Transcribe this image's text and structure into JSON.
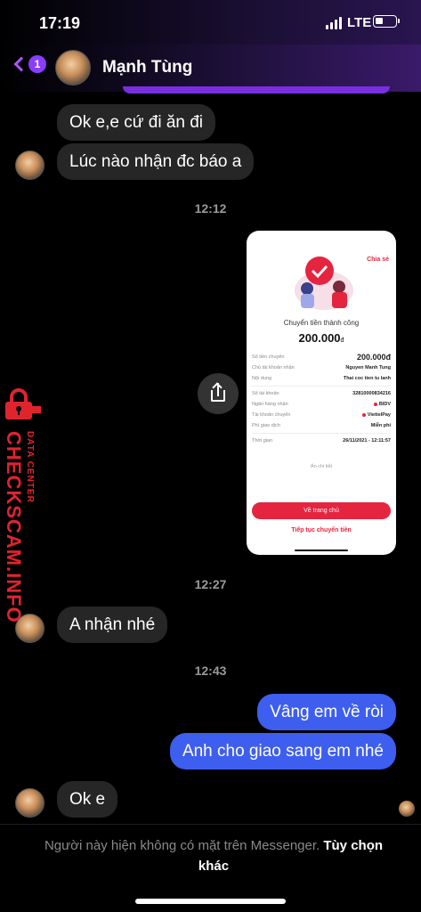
{
  "status_bar": {
    "time": "17:19",
    "network": "LTE"
  },
  "header": {
    "back_badge": "1",
    "contact_name": "Mạnh Tùng"
  },
  "messages": {
    "m1": "Ok e,e cứ đi ăn đi",
    "m2": "Lúc nào nhận đc báo a",
    "t1": "12:12",
    "t2": "12:27",
    "m3": "A nhận nhé",
    "t3": "12:43",
    "m4": "Vâng em về ròi",
    "m5": "Anh cho giao sang em nhé",
    "m6": "Ok e"
  },
  "receipt": {
    "share": "Chia sẻ",
    "title": "Chuyển tiền thành công",
    "amount": "200.000",
    "currency": "đ",
    "rows": [
      {
        "k": "Số tiền chuyển",
        "v": "200.000đ"
      },
      {
        "k": "Chủ tài khoản nhận",
        "v": "Nguyen Manh Tung"
      },
      {
        "k": "Nội dung",
        "v": "Thai coc tien tu lanh"
      },
      {
        "k": "Số tài khoản",
        "v": "32810000834216"
      },
      {
        "k": "Ngân hàng nhận",
        "v": "BIDV"
      },
      {
        "k": "Tài khoản chuyển",
        "v": "ViettelPay"
      },
      {
        "k": "Phí giao dịch",
        "v": "Miễn phí"
      },
      {
        "k": "Thời gian",
        "v": "26/11/2021 - 12:11:57"
      }
    ],
    "hide_details": "Ẩn chi tiết",
    "home_button": "Về trang chủ",
    "continue_link": "Tiếp tục chuyển tiền",
    "accent_color": "#e5243f"
  },
  "watermark": {
    "brand": "CHECKSCAM.INFO",
    "sub": "DATA CENTER"
  },
  "footer": {
    "notice": "Người này hiện không có mặt trên Messenger.",
    "more": "Tùy chọn khác"
  },
  "colors": {
    "outgoing_bubble": "#3e5ef0",
    "incoming_bubble": "#262626",
    "accent_purple": "#8b3dff"
  }
}
